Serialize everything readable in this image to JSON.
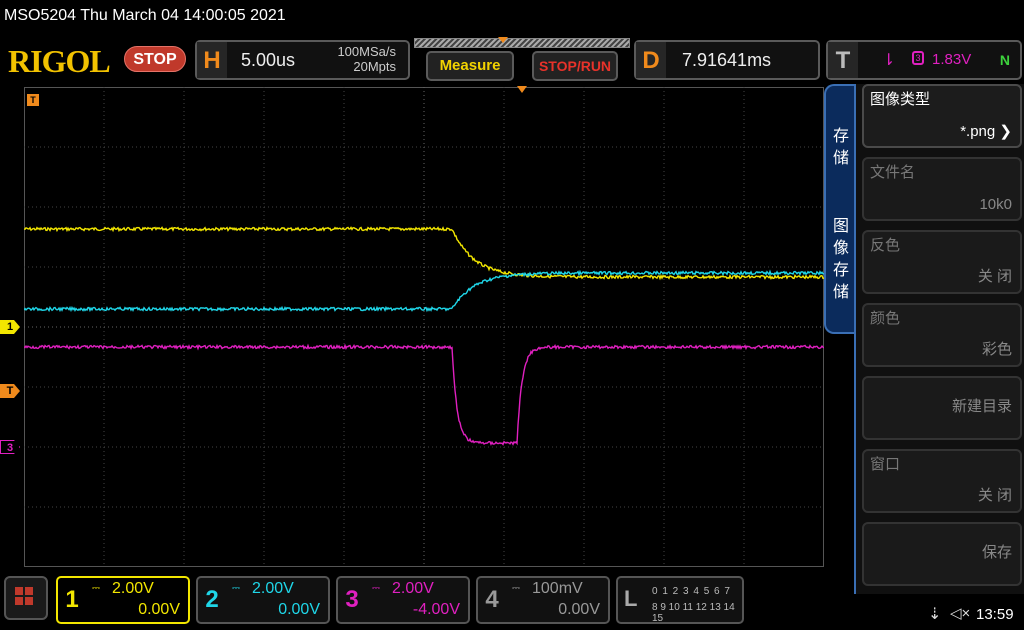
{
  "status": {
    "model": "MSO5204",
    "datetime": "Thu March 04 14:00:05 2021"
  },
  "header": {
    "logo": "RIGOL",
    "run_state": "STOP",
    "horizontal": {
      "letter": "H",
      "timebase": "5.00us",
      "sample_rate": "100MSa/s",
      "memory_depth": "20Mpts"
    },
    "measure_label": "Measure",
    "stoprun_label": "STOP/RUN",
    "delay": {
      "letter": "D",
      "value": "7.91641ms"
    },
    "trigger": {
      "letter": "T",
      "source": "3",
      "level": "1.83V",
      "status": "N"
    }
  },
  "screen": {
    "markers": {
      "ch1": "1",
      "trigger": "T",
      "ch3": "3",
      "corner": "T"
    }
  },
  "side_tab": {
    "save": "存储",
    "image_save": "图像存储"
  },
  "menu": {
    "items": [
      {
        "label": "图像类型",
        "value": "*.png"
      },
      {
        "label": "文件名",
        "value": "10k0"
      },
      {
        "label": "反色",
        "value": "关 闭"
      },
      {
        "label": "颜色",
        "value": "彩色"
      },
      {
        "label": "",
        "value": "新建目录"
      },
      {
        "label": "窗口",
        "value": "关 闭"
      },
      {
        "label": "",
        "value": "保存"
      }
    ]
  },
  "channels": [
    {
      "num": "1",
      "scale": "2.00V",
      "offset": "0.00V",
      "color": "#f2e600"
    },
    {
      "num": "2",
      "scale": "2.00V",
      "offset": "0.00V",
      "color": "#1fd6e8"
    },
    {
      "num": "3",
      "scale": "2.00V",
      "offset": "-4.00V",
      "color": "#e020c0"
    },
    {
      "num": "4",
      "scale": "100mV",
      "offset": "0.00V",
      "color": "#999999"
    }
  ],
  "logic": {
    "letter": "L",
    "row1": "0 1 2 3  4 5 6 7",
    "row2": "8 9 10 11 12 13 14 15"
  },
  "clock": "13:59",
  "icons": {
    "usb": "usb-icon",
    "speaker": "speaker-icon",
    "home": "home-icon"
  }
}
